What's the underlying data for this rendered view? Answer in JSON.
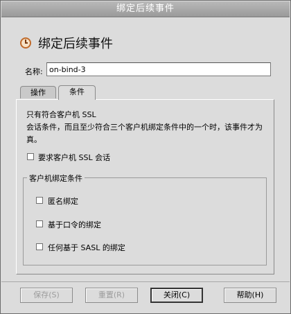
{
  "window": {
    "title": "绑定后续事件"
  },
  "header": {
    "title": "绑定后续事件",
    "icon": "clock-icon"
  },
  "name_field": {
    "label": "名称:",
    "value": "on-bind-3"
  },
  "tabs": [
    {
      "label": "操作",
      "selected": false
    },
    {
      "label": "条件",
      "selected": true
    }
  ],
  "description": {
    "line1": "只有符合客户机 SSL",
    "line2": "会话条件，而且至少符合三个客户机绑定条件中的一个时，该事件才为",
    "line3": "真。"
  },
  "require_ssl": {
    "label": "要求客户机 SSL 会话",
    "checked": false
  },
  "bind_conditions": {
    "title": "客户机绑定条件",
    "items": [
      {
        "label": "匿名绑定",
        "checked": false
      },
      {
        "label": "基于口令的绑定",
        "checked": false
      },
      {
        "label": "任何基于 SASL 的绑定",
        "checked": false
      }
    ]
  },
  "buttons": {
    "save": "保存(S)",
    "reset": "重置(R)",
    "close": "关闭(C)",
    "help": "帮助(H)"
  }
}
